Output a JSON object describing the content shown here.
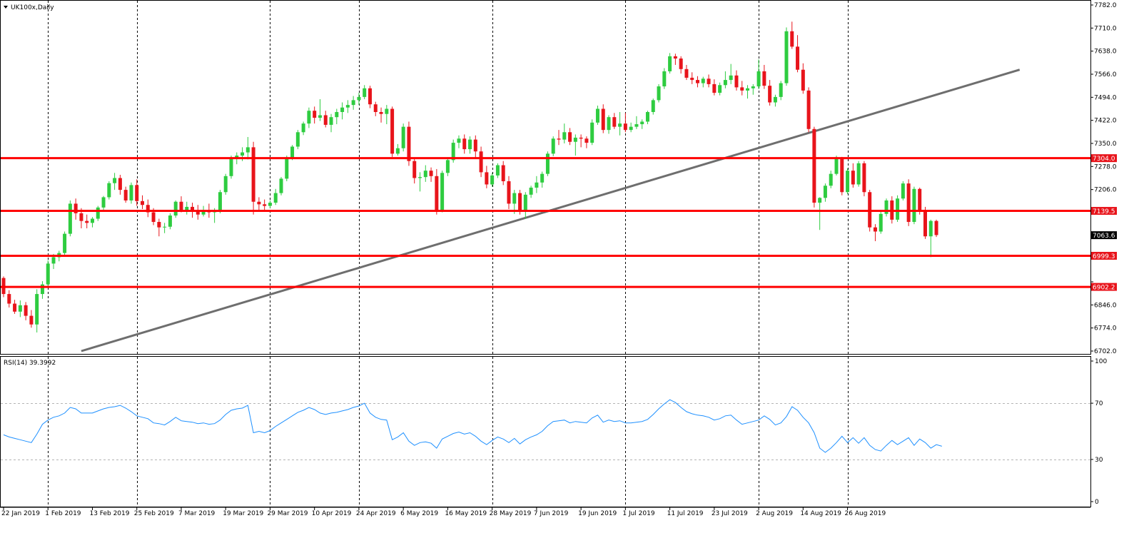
{
  "window": {
    "symbol_label": "UK100x,Daily",
    "indicator_label": "RSI(14) 39.3992"
  },
  "colors": {
    "bull": "#2ecc40",
    "bear": "#e8141b",
    "level_line": "#ff0000",
    "trendline": "#6e6e6e",
    "rsi_line": "#1e90ff",
    "current_price_tag": "#000000",
    "level_tag": "#e8141b"
  },
  "chart_data": {
    "type": "candlestick",
    "title": "UK100x,Daily",
    "y_ticks": [
      7782.0,
      7710.0,
      7638.0,
      7566.0,
      7494.0,
      7422.0,
      7350.0,
      7278.0,
      7206.0,
      7134.0,
      7062.0,
      6990.0,
      6918.0,
      6846.0,
      6774.0,
      6702.0
    ],
    "y_tick_labels": [
      "7782.0",
      "7710.0",
      "7638.0",
      "7566.0",
      "7494.0",
      "7422.0",
      "7350.0",
      "7278.0",
      "7206.0",
      "",
      "",
      "",
      "",
      "6846.0",
      "6774.0",
      "6702.0"
    ],
    "ylim": [
      6702.0,
      7782.0
    ],
    "x_tick_labels": [
      "22 Jan 2019",
      "1 Feb 2019",
      "13 Feb 2019",
      "25 Feb 2019",
      "7 Mar 2019",
      "19 Mar 2019",
      "29 Mar 2019",
      "10 Apr 2019",
      "24 Apr 2019",
      "6 May 2019",
      "16 May 2019",
      "28 May 2019",
      "7 Jun 2019",
      "19 Jun 2019",
      "1 Jul 2019",
      "11 Jul 2019",
      "23 Jul 2019",
      "2 Aug 2019",
      "14 Aug 2019",
      "26 Aug 2019"
    ],
    "x_tick_index": [
      0,
      8,
      16,
      24,
      32,
      40,
      48,
      56,
      64,
      72,
      80,
      88,
      96,
      104,
      112,
      120,
      128,
      136,
      144,
      152
    ],
    "separators_index": [
      8,
      24,
      48,
      64,
      88,
      112,
      136,
      152
    ],
    "current_price": 7063.6,
    "current_price_label": "7063.6",
    "horizontal_levels": [
      {
        "value": 7304.0,
        "label": "7304.0"
      },
      {
        "value": 7139.5,
        "label": "7139.5"
      },
      {
        "value": 6999.3,
        "label": "6999.3"
      },
      {
        "value": 6902.2,
        "label": "6902.2"
      }
    ],
    "trendline": {
      "start": {
        "index": 14,
        "price": 6702
      },
      "end": {
        "index": 183,
        "price": 7580
      }
    },
    "candles": [
      [
        6930,
        6935,
        6870,
        6880
      ],
      [
        6880,
        6892,
        6838,
        6850
      ],
      [
        6850,
        6862,
        6818,
        6825
      ],
      [
        6825,
        6860,
        6808,
        6845
      ],
      [
        6845,
        6855,
        6798,
        6812
      ],
      [
        6812,
        6830,
        6775,
        6785
      ],
      [
        6785,
        6895,
        6760,
        6880
      ],
      [
        6880,
        6920,
        6865,
        6910
      ],
      [
        6910,
        6985,
        6902,
        6975
      ],
      [
        6975,
        7005,
        6958,
        6995
      ],
      [
        6995,
        7015,
        6982,
        7008
      ],
      [
        7008,
        7075,
        7000,
        7068
      ],
      [
        7068,
        7172,
        7060,
        7162
      ],
      [
        7162,
        7178,
        7112,
        7132
      ],
      [
        7132,
        7148,
        7085,
        7108
      ],
      [
        7108,
        7128,
        7085,
        7102
      ],
      [
        7102,
        7120,
        7088,
        7115
      ],
      [
        7115,
        7155,
        7108,
        7150
      ],
      [
        7150,
        7186,
        7140,
        7182
      ],
      [
        7182,
        7232,
        7175,
        7226
      ],
      [
        7226,
        7258,
        7205,
        7242
      ],
      [
        7242,
        7252,
        7190,
        7205
      ],
      [
        7205,
        7215,
        7165,
        7172
      ],
      [
        7172,
        7228,
        7162,
        7220
      ],
      [
        7220,
        7238,
        7155,
        7170
      ],
      [
        7170,
        7188,
        7145,
        7158
      ],
      [
        7158,
        7175,
        7120,
        7135
      ],
      [
        7135,
        7148,
        7095,
        7105
      ],
      [
        7105,
        7115,
        7060,
        7088
      ],
      [
        7088,
        7102,
        7070,
        7090
      ],
      [
        7090,
        7132,
        7082,
        7125
      ],
      [
        7125,
        7172,
        7118,
        7168
      ],
      [
        7168,
        7185,
        7135,
        7142
      ],
      [
        7142,
        7168,
        7128,
        7152
      ],
      [
        7152,
        7165,
        7118,
        7138
      ],
      [
        7138,
        7158,
        7112,
        7128
      ],
      [
        7128,
        7155,
        7122,
        7142
      ],
      [
        7142,
        7162,
        7118,
        7135
      ],
      [
        7135,
        7148,
        7102,
        7140
      ],
      [
        7140,
        7205,
        7132,
        7198
      ],
      [
        7198,
        7255,
        7190,
        7248
      ],
      [
        7248,
        7312,
        7240,
        7305
      ],
      [
        7305,
        7322,
        7285,
        7312
      ],
      [
        7312,
        7338,
        7295,
        7322
      ],
      [
        7322,
        7370,
        7300,
        7338
      ],
      [
        7338,
        7355,
        7128,
        7168
      ],
      [
        7168,
        7182,
        7138,
        7160
      ],
      [
        7160,
        7175,
        7140,
        7155
      ],
      [
        7155,
        7172,
        7148,
        7165
      ],
      [
        7165,
        7208,
        7158,
        7195
      ],
      [
        7195,
        7245,
        7188,
        7240
      ],
      [
        7240,
        7312,
        7232,
        7305
      ],
      [
        7305,
        7345,
        7298,
        7340
      ],
      [
        7340,
        7392,
        7332,
        7385
      ],
      [
        7385,
        7418,
        7376,
        7412
      ],
      [
        7412,
        7462,
        7398,
        7452
      ],
      [
        7452,
        7465,
        7412,
        7430
      ],
      [
        7430,
        7488,
        7420,
        7438
      ],
      [
        7438,
        7452,
        7400,
        7408
      ],
      [
        7408,
        7442,
        7385,
        7432
      ],
      [
        7432,
        7458,
        7410,
        7448
      ],
      [
        7448,
        7478,
        7425,
        7462
      ],
      [
        7462,
        7485,
        7445,
        7470
      ],
      [
        7470,
        7498,
        7455,
        7485
      ],
      [
        7485,
        7508,
        7470,
        7495
      ],
      [
        7495,
        7532,
        7488,
        7522
      ],
      [
        7522,
        7530,
        7460,
        7472
      ],
      [
        7472,
        7480,
        7435,
        7448
      ],
      [
        7448,
        7462,
        7415,
        7442
      ],
      [
        7442,
        7470,
        7410,
        7458
      ],
      [
        7458,
        7465,
        7308,
        7318
      ],
      [
        7318,
        7348,
        7312,
        7335
      ],
      [
        7335,
        7412,
        7325,
        7402
      ],
      [
        7402,
        7418,
        7280,
        7295
      ],
      [
        7295,
        7305,
        7225,
        7242
      ],
      [
        7242,
        7260,
        7200,
        7245
      ],
      [
        7245,
        7282,
        7230,
        7265
      ],
      [
        7265,
        7275,
        7230,
        7248
      ],
      [
        7248,
        7270,
        7128,
        7142
      ],
      [
        7142,
        7265,
        7135,
        7258
      ],
      [
        7258,
        7305,
        7248,
        7298
      ],
      [
        7298,
        7362,
        7290,
        7352
      ],
      [
        7352,
        7375,
        7335,
        7365
      ],
      [
        7365,
        7378,
        7318,
        7332
      ],
      [
        7332,
        7372,
        7318,
        7362
      ],
      [
        7362,
        7375,
        7305,
        7325
      ],
      [
        7325,
        7340,
        7245,
        7260
      ],
      [
        7260,
        7280,
        7210,
        7222
      ],
      [
        7222,
        7258,
        7215,
        7250
      ],
      [
        7250,
        7288,
        7242,
        7282
      ],
      [
        7282,
        7295,
        7220,
        7232
      ],
      [
        7232,
        7248,
        7145,
        7162
      ],
      [
        7162,
        7205,
        7130,
        7195
      ],
      [
        7195,
        7205,
        7128,
        7142
      ],
      [
        7142,
        7198,
        7115,
        7190
      ],
      [
        7190,
        7218,
        7180,
        7212
      ],
      [
        7212,
        7248,
        7195,
        7228
      ],
      [
        7228,
        7262,
        7212,
        7255
      ],
      [
        7255,
        7325,
        7248,
        7318
      ],
      [
        7318,
        7372,
        7310,
        7365
      ],
      [
        7365,
        7392,
        7345,
        7362
      ],
      [
        7362,
        7412,
        7350,
        7385
      ],
      [
        7385,
        7398,
        7345,
        7355
      ],
      [
        7355,
        7378,
        7312,
        7368
      ],
      [
        7368,
        7378,
        7338,
        7365
      ],
      [
        7365,
        7372,
        7335,
        7352
      ],
      [
        7352,
        7425,
        7345,
        7415
      ],
      [
        7415,
        7468,
        7408,
        7458
      ],
      [
        7458,
        7472,
        7382,
        7392
      ],
      [
        7392,
        7438,
        7380,
        7432
      ],
      [
        7432,
        7445,
        7395,
        7402
      ],
      [
        7402,
        7448,
        7375,
        7412
      ],
      [
        7412,
        7445,
        7385,
        7392
      ],
      [
        7392,
        7415,
        7385,
        7402
      ],
      [
        7402,
        7435,
        7395,
        7410
      ],
      [
        7410,
        7425,
        7395,
        7418
      ],
      [
        7418,
        7452,
        7410,
        7448
      ],
      [
        7448,
        7490,
        7440,
        7485
      ],
      [
        7485,
        7535,
        7478,
        7528
      ],
      [
        7528,
        7585,
        7520,
        7575
      ],
      [
        7575,
        7632,
        7568,
        7622
      ],
      [
        7622,
        7630,
        7595,
        7615
      ],
      [
        7615,
        7622,
        7568,
        7582
      ],
      [
        7582,
        7595,
        7548,
        7555
      ],
      [
        7555,
        7572,
        7535,
        7548
      ],
      [
        7548,
        7560,
        7525,
        7538
      ],
      [
        7538,
        7558,
        7525,
        7552
      ],
      [
        7552,
        7565,
        7525,
        7535
      ],
      [
        7535,
        7550,
        7500,
        7508
      ],
      [
        7508,
        7540,
        7500,
        7532
      ],
      [
        7532,
        7575,
        7522,
        7548
      ],
      [
        7548,
        7598,
        7535,
        7562
      ],
      [
        7562,
        7578,
        7515,
        7525
      ],
      [
        7525,
        7545,
        7500,
        7515
      ],
      [
        7515,
        7532,
        7490,
        7522
      ],
      [
        7522,
        7535,
        7502,
        7528
      ],
      [
        7528,
        7612,
        7520,
        7575
      ],
      [
        7575,
        7595,
        7520,
        7530
      ],
      [
        7530,
        7548,
        7468,
        7478
      ],
      [
        7478,
        7502,
        7465,
        7495
      ],
      [
        7495,
        7545,
        7485,
        7538
      ],
      [
        7538,
        7712,
        7530,
        7700
      ],
      [
        7700,
        7730,
        7645,
        7652
      ],
      [
        7652,
        7688,
        7572,
        7580
      ],
      [
        7580,
        7600,
        7505,
        7515
      ],
      [
        7515,
        7525,
        7385,
        7395
      ],
      [
        7395,
        7402,
        7150,
        7165
      ],
      [
        7165,
        7182,
        7080,
        7180
      ],
      [
        7180,
        7225,
        7168,
        7218
      ],
      [
        7218,
        7265,
        7210,
        7255
      ],
      [
        7255,
        7312,
        7250,
        7302
      ],
      [
        7302,
        7308,
        7188,
        7198
      ],
      [
        7198,
        7272,
        7192,
        7265
      ],
      [
        7265,
        7288,
        7212,
        7222
      ],
      [
        7222,
        7295,
        7215,
        7288
      ],
      [
        7288,
        7295,
        7185,
        7198
      ],
      [
        7198,
        7205,
        7075,
        7088
      ],
      [
        7088,
        7098,
        7045,
        7075
      ],
      [
        7075,
        7142,
        7068,
        7130
      ],
      [
        7130,
        7178,
        7122,
        7172
      ],
      [
        7172,
        7185,
        7100,
        7112
      ],
      [
        7112,
        7188,
        7105,
        7178
      ],
      [
        7178,
        7232,
        7172,
        7225
      ],
      [
        7225,
        7238,
        7092,
        7105
      ],
      [
        7105,
        7215,
        7098,
        7208
      ],
      [
        7208,
        7212,
        7128,
        7142
      ],
      [
        7142,
        7152,
        7052,
        7060
      ],
      [
        7060,
        7112,
        6995,
        7108
      ],
      [
        7108,
        7112,
        7058,
        7064
      ]
    ],
    "rsi": [
      47.5,
      46.0,
      45.0,
      44.0,
      43.0,
      42.0,
      48.0,
      55.0,
      58.0,
      60.0,
      61.0,
      63.0,
      67.0,
      66.0,
      63.0,
      63.0,
      63.0,
      64.5,
      66.0,
      67.0,
      67.5,
      68.5,
      66.5,
      64.0,
      61.0,
      60.0,
      59.0,
      56.0,
      55.5,
      54.5,
      57.0,
      60.0,
      57.5,
      57.0,
      56.5,
      55.5,
      56.0,
      55.0,
      55.5,
      58.0,
      62.0,
      65.0,
      66.0,
      66.5,
      68.5,
      49.0,
      50.0,
      49.0,
      50.5,
      53.5,
      56.0,
      58.5,
      61.0,
      63.5,
      65.0,
      67.0,
      65.5,
      63.0,
      62.0,
      63.0,
      63.5,
      64.5,
      65.5,
      67.0,
      68.0,
      70.0,
      63.0,
      60.0,
      58.5,
      58.0,
      44.0,
      46.0,
      49.0,
      43.0,
      40.0,
      42.0,
      42.5,
      41.5,
      38.0,
      44.5,
      46.5,
      48.5,
      49.5,
      48.0,
      49.0,
      46.5,
      43.0,
      40.5,
      43.5,
      46.0,
      44.5,
      42.0,
      45.0,
      41.0,
      44.0,
      46.0,
      47.5,
      50.0,
      54.0,
      57.0,
      57.5,
      58.0,
      56.0,
      57.0,
      56.5,
      56.0,
      59.5,
      61.5,
      56.5,
      58.0,
      57.0,
      57.5,
      56.0,
      56.0,
      56.5,
      57.0,
      58.5,
      62.0,
      66.0,
      69.5,
      72.5,
      70.5,
      67.0,
      64.0,
      62.5,
      61.5,
      61.0,
      60.0,
      58.0,
      59.0,
      61.0,
      61.5,
      58.0,
      55.0,
      56.0,
      57.0,
      58.0,
      61.0,
      58.5,
      54.5,
      56.0,
      60.5,
      67.5,
      65.0,
      60.0,
      56.0,
      49.0,
      38.0,
      35.0,
      38.0,
      42.0,
      46.5,
      42.0,
      45.5,
      41.5,
      45.5,
      40.0,
      37.0,
      36.0,
      40.0,
      43.5,
      40.5,
      43.0,
      45.5,
      40.0,
      44.5,
      42.0,
      38.0,
      40.5,
      39.4
    ],
    "rsi_levels": [
      70,
      30
    ],
    "rsi_axis_labels": [
      "100",
      "70",
      "30",
      "0"
    ]
  }
}
